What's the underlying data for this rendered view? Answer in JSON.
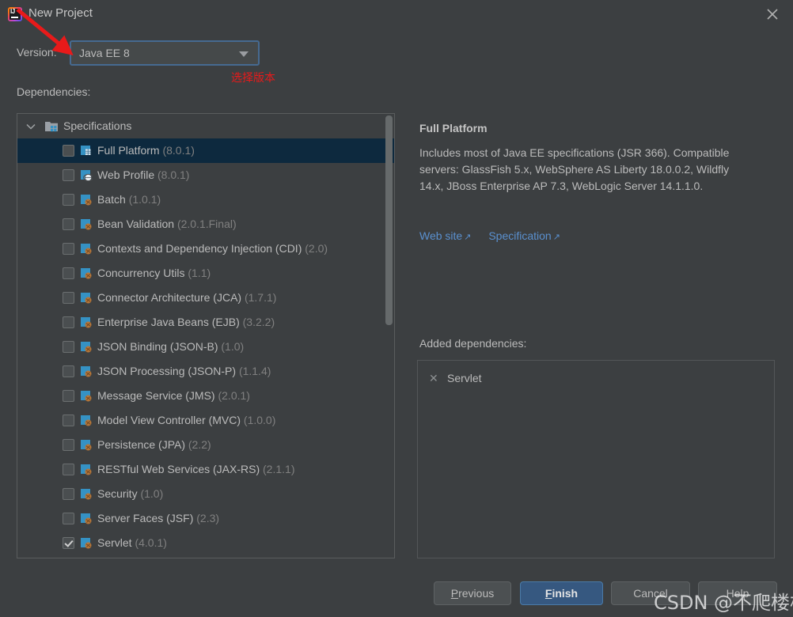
{
  "window": {
    "title": "New Project",
    "logo_icon": "intellij-idea-logo",
    "close_icon": "close-icon"
  },
  "version_row": {
    "label": "Version:",
    "selected": "Java EE 8",
    "dropdown_icon": "chevron-down-icon"
  },
  "annotations": {
    "arrow_color": "#e81a1a",
    "note_text": "选择版本"
  },
  "dependencies": {
    "label": "Dependencies:",
    "group": {
      "label": "Specifications",
      "expanded": true,
      "chevron_icon": "chevron-down-icon",
      "folder_icon": "specifications-folder-icon"
    },
    "items": [
      {
        "name": "Full Platform",
        "version": "(8.0.1)",
        "checked": false,
        "selected": true,
        "icon": "full-platform-icon"
      },
      {
        "name": "Web Profile",
        "version": "(8.0.1)",
        "checked": false,
        "selected": false,
        "icon": "web-profile-icon"
      },
      {
        "name": "Batch",
        "version": "(1.0.1)",
        "checked": false,
        "selected": false,
        "icon": "java-spec-icon"
      },
      {
        "name": "Bean Validation",
        "version": "(2.0.1.Final)",
        "checked": false,
        "selected": false,
        "icon": "java-spec-icon"
      },
      {
        "name": "Contexts and Dependency Injection (CDI)",
        "version": "(2.0)",
        "checked": false,
        "selected": false,
        "icon": "java-spec-icon"
      },
      {
        "name": "Concurrency Utils",
        "version": "(1.1)",
        "checked": false,
        "selected": false,
        "icon": "java-spec-icon"
      },
      {
        "name": "Connector Architecture (JCA)",
        "version": "(1.7.1)",
        "checked": false,
        "selected": false,
        "icon": "java-spec-icon"
      },
      {
        "name": "Enterprise Java Beans (EJB)",
        "version": "(3.2.2)",
        "checked": false,
        "selected": false,
        "icon": "java-spec-icon"
      },
      {
        "name": "JSON Binding (JSON-B)",
        "version": "(1.0)",
        "checked": false,
        "selected": false,
        "icon": "java-spec-icon"
      },
      {
        "name": "JSON Processing (JSON-P)",
        "version": "(1.1.4)",
        "checked": false,
        "selected": false,
        "icon": "java-spec-icon"
      },
      {
        "name": "Message Service (JMS)",
        "version": "(2.0.1)",
        "checked": false,
        "selected": false,
        "icon": "java-spec-icon"
      },
      {
        "name": "Model View Controller (MVC)",
        "version": "(1.0.0)",
        "checked": false,
        "selected": false,
        "icon": "java-spec-icon"
      },
      {
        "name": "Persistence (JPA)",
        "version": "(2.2)",
        "checked": false,
        "selected": false,
        "icon": "java-spec-icon"
      },
      {
        "name": "RESTful Web Services (JAX-RS)",
        "version": "(2.1.1)",
        "checked": false,
        "selected": false,
        "icon": "java-spec-icon"
      },
      {
        "name": "Security",
        "version": "(1.0)",
        "checked": false,
        "selected": false,
        "icon": "java-spec-icon"
      },
      {
        "name": "Server Faces (JSF)",
        "version": "(2.3)",
        "checked": false,
        "selected": false,
        "icon": "java-spec-icon"
      },
      {
        "name": "Servlet",
        "version": "(4.0.1)",
        "checked": true,
        "selected": false,
        "icon": "java-spec-icon"
      }
    ]
  },
  "detail": {
    "title": "Full Platform",
    "description": "Includes most of Java EE specifications (JSR 366). Compatible servers: GlassFish 5.x, WebSphere AS Liberty 18.0.0.2, Wildfly 14.x, JBoss Enterprise AP 7.3, WebLogic Server 14.1.1.0.",
    "links": [
      {
        "label": "Web site",
        "icon": "external-link-icon"
      },
      {
        "label": "Specification",
        "icon": "external-link-icon"
      }
    ]
  },
  "added_dependencies": {
    "label": "Added dependencies:",
    "items": [
      {
        "name": "Servlet",
        "remove_icon": "close-icon"
      }
    ]
  },
  "buttons": {
    "previous": {
      "mnemonic": "P",
      "rest": "revious"
    },
    "finish": {
      "mnemonic": "F",
      "rest": "inish"
    },
    "cancel": "Cancel",
    "help": "Help"
  },
  "watermark": "CSDN @不爬楼梯",
  "colors": {
    "background": "#3c3f41",
    "selection": "#0d293e",
    "accent_blue": "#365880",
    "link_blue": "#5a90cf",
    "annotation_red": "#e81a1a",
    "spec_icon_blue": "#3592c4"
  }
}
